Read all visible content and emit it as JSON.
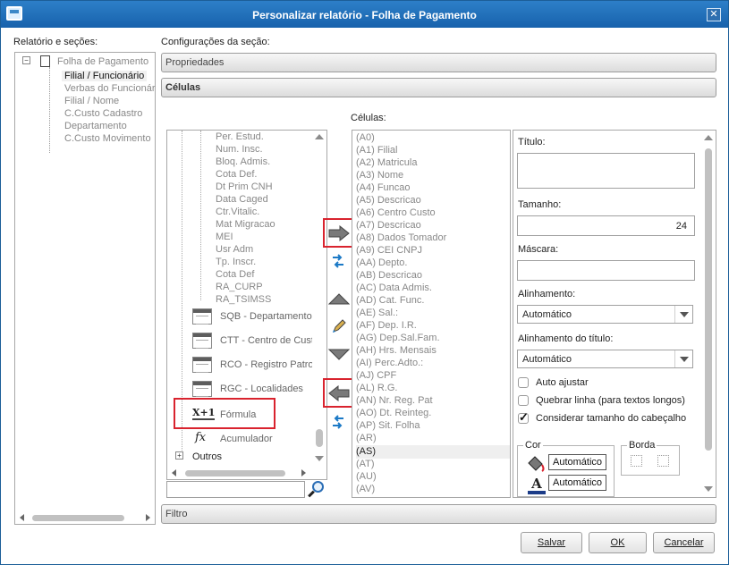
{
  "window": {
    "title": "Personalizar relatório - Folha de Pagamento",
    "close_icon": "close-icon"
  },
  "left": {
    "label": "Relatório e seções:",
    "tree": [
      {
        "label": "Folha de Pagamento"
      },
      {
        "label": "Filial / Funcionário"
      },
      {
        "label": "Verbas do Funcionário"
      },
      {
        "label": "Filial / Nome"
      },
      {
        "label": "C.Custo Cadastro"
      },
      {
        "label": "Departamento"
      },
      {
        "label": "C.Custo Movimento"
      }
    ]
  },
  "right": {
    "label": "Configurações da seção:",
    "sections": {
      "props": "Propriedades",
      "cells": "Células",
      "filter": "Filtro"
    }
  },
  "fields": {
    "items": [
      "Per. Estud.",
      "Num. Insc.",
      "Bloq. Admis.",
      "Cota Def.",
      "Dt Prim CNH",
      "Data Caged",
      "Ctr.Vitalic.",
      "Mat Migracao",
      "MEI",
      "Usr Adm",
      "Tp. Inscr.",
      "Cota Def",
      "RA_CURP",
      "RA_TSIMSS"
    ],
    "tables": [
      "SQB - Departamento",
      "CTT - Centro de Custo",
      "RCO - Registro Patronal",
      "RGC - Localidades"
    ],
    "formula": "Fórmula",
    "accum": "Acumulador",
    "others": "Outros",
    "search_value": ""
  },
  "cells": {
    "label": "Células:",
    "items": [
      "(A0)",
      "(A1) Filial",
      "(A2) Matricula",
      "(A3) Nome",
      "(A4) Funcao",
      "(A5) Descricao",
      "(A6) Centro Custo",
      "(A7) Descricao",
      "(A8) Dados Tomador",
      "(A9) CEI CNPJ",
      "(AA) Depto.",
      "(AB) Descricao",
      "(AC) Data Admis.",
      "(AD) Cat. Func.",
      "(AE) Sal.:",
      "(AF) Dep. I.R.",
      "(AG) Dep.Sal.Fam.",
      "(AH) Hrs. Mensais",
      "(AI) Perc.Adto.:",
      "(AJ) CPF",
      "(AL) R.G.",
      "(AN) Nr. Reg. Pat",
      "(AO) Dt. Reinteg.",
      "(AP) Sit. Folha",
      "(AR)",
      "(AS)",
      "(AT)",
      "(AU)",
      "(AV)"
    ]
  },
  "props": {
    "title_label": "Título:",
    "title_value": "",
    "size_label": "Tamanho:",
    "size_value": "24",
    "mask_label": "Máscara:",
    "mask_value": "",
    "align_label": "Alinhamento:",
    "align_value": "Automático",
    "title_align_label": "Alinhamento do título:",
    "title_align_value": "Automático",
    "auto_adjust": "Auto ajustar",
    "wrap": "Quebrar linha (para textos longos)",
    "header_size": "Considerar tamanho do cabeçalho",
    "color_label": "Cor",
    "border_label": "Borda",
    "auto_text": "Automático",
    "auto_bg": "Automático"
  },
  "buttons": {
    "save": "Salvar",
    "ok": "OK",
    "cancel": "Cancelar"
  }
}
